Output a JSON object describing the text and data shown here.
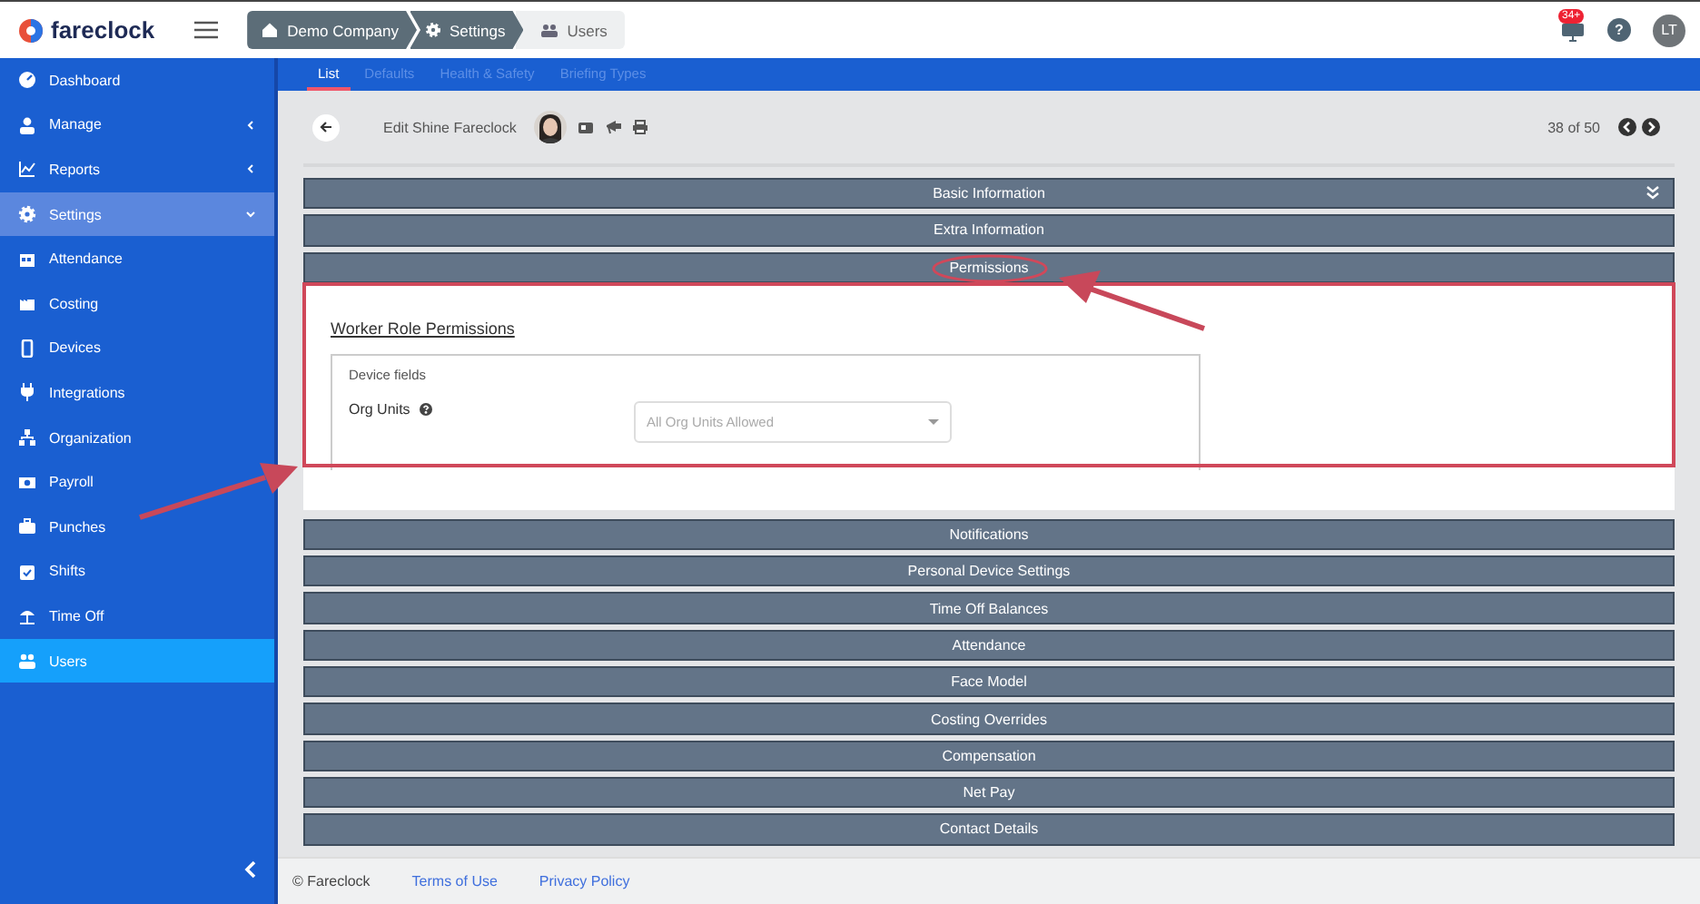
{
  "brand": {
    "name": "fareclock"
  },
  "breadcrumb": [
    {
      "label": "Demo Company"
    },
    {
      "label": "Settings"
    },
    {
      "label": "Users"
    }
  ],
  "header_actions": {
    "notification_badge": "34+",
    "help": "?",
    "avatar": "LT"
  },
  "sidebar": {
    "items": [
      {
        "label": "Dashboard",
        "selected": false
      },
      {
        "label": "Manage",
        "selected": false,
        "expanded": false
      },
      {
        "label": "Reports",
        "selected": false,
        "expanded": false
      },
      {
        "label": "Settings",
        "selected": false,
        "expanded": true,
        "children": [
          {
            "label": "Attendance",
            "selected": false
          },
          {
            "label": "Costing",
            "selected": false
          },
          {
            "label": "Devices",
            "selected": false
          },
          {
            "label": "Integrations",
            "selected": false
          },
          {
            "label": "Organization",
            "selected": false
          },
          {
            "label": "Payroll",
            "selected": false
          },
          {
            "label": "Punches",
            "selected": false
          },
          {
            "label": "Shifts",
            "selected": false
          },
          {
            "label": "Time Off",
            "selected": false
          },
          {
            "label": "Users",
            "selected": true
          }
        ]
      }
    ]
  },
  "tabs": [
    {
      "label": "List",
      "selected": true
    },
    {
      "label": "Defaults",
      "selected": false
    },
    {
      "label": "Health & Safety",
      "selected": false
    },
    {
      "label": "Briefing Types",
      "selected": false
    }
  ],
  "toolbar": {
    "title": "Edit Shine Fareclock",
    "pager": "38 of 50"
  },
  "sections": [
    {
      "title": "Basic Information",
      "expanded": false
    },
    {
      "title": "Extra Information",
      "expanded": false
    },
    {
      "title": "Permissions",
      "expanded": true,
      "content": {
        "heading": "Worker Role Permissions",
        "group_label": "Device fields",
        "field_label": "Org Units",
        "select_placeholder": "All Org Units Allowed"
      }
    },
    {
      "title": "Notifications",
      "expanded": false
    },
    {
      "title": "Personal Device Settings",
      "expanded": false
    },
    {
      "title": "Time Off Balances",
      "expanded": false
    },
    {
      "title": "Attendance",
      "expanded": false
    },
    {
      "title": "Face Model",
      "expanded": false
    },
    {
      "title": "Costing Overrides",
      "expanded": false
    },
    {
      "title": "Compensation",
      "expanded": false
    },
    {
      "title": "Net Pay",
      "expanded": false
    },
    {
      "title": "Contact Details",
      "expanded": false
    }
  ],
  "footer": {
    "copyright": "© Fareclock",
    "links": [
      "Terms of Use",
      "Privacy Policy"
    ]
  }
}
